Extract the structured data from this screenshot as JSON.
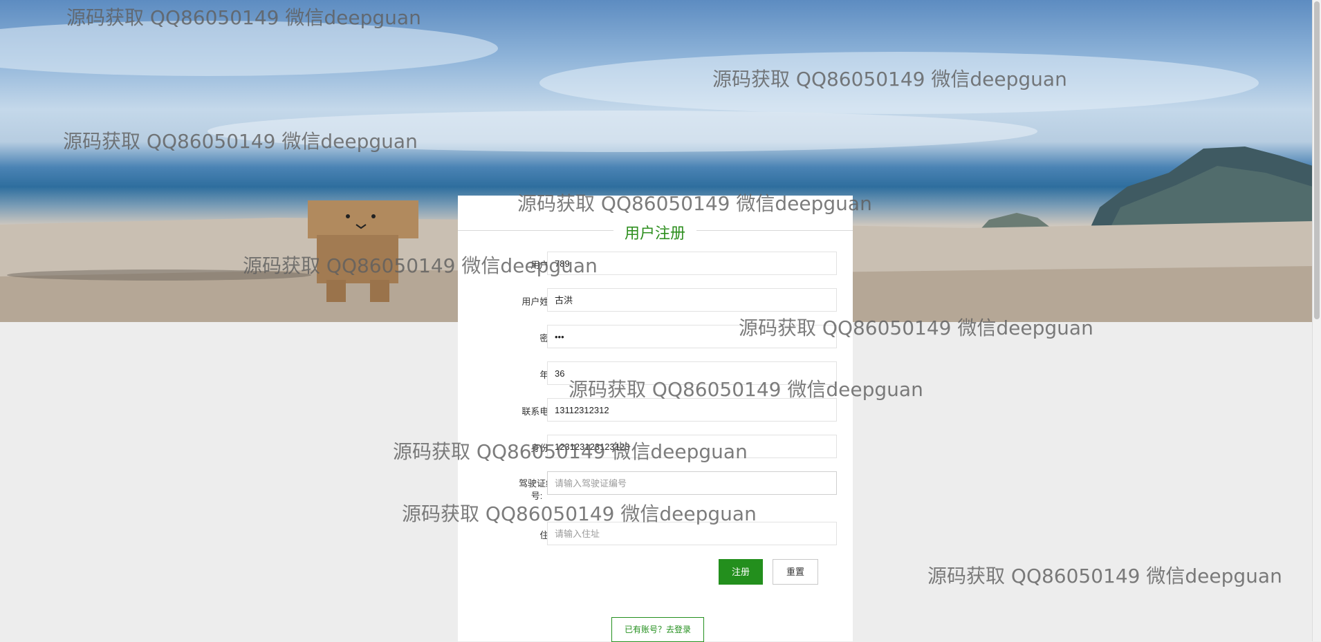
{
  "form": {
    "title": "用户注册",
    "fields": [
      {
        "label": "用户名:",
        "value": "789",
        "placeholder": ""
      },
      {
        "label": "用户姓名:",
        "value": "古洪",
        "placeholder": ""
      },
      {
        "label": "密码:",
        "value": "•••",
        "placeholder": ""
      },
      {
        "label": "年龄:",
        "value": "36",
        "placeholder": ""
      },
      {
        "label": "联系电话:",
        "value": "13112312312",
        "placeholder": ""
      },
      {
        "label": "身份证:",
        "value": "123123123123123",
        "placeholder": ""
      },
      {
        "label": "驾驶证编号:",
        "value": "",
        "placeholder": "请输入驾驶证编号"
      },
      {
        "label": "住址:",
        "value": "",
        "placeholder": "请输入住址"
      }
    ],
    "register_label": "注册",
    "reset_label": "重置",
    "login_link": "已有账号？去登录"
  },
  "watermark": "源码获取 QQ86050149 微信deepguan",
  "colors": {
    "accent": "#238f1d",
    "title": "#2e8f1f"
  }
}
